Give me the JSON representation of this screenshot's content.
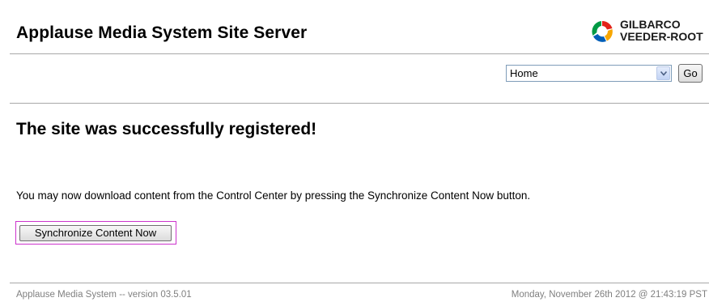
{
  "header": {
    "app_title": "Applause Media System Site Server",
    "logo": {
      "line1": "GILBARCO",
      "line2": "VEEDER-ROOT",
      "colors": [
        "#e2231a",
        "#f7a600",
        "#005eb8",
        "#009a44"
      ]
    }
  },
  "nav": {
    "selected_option": "Home",
    "go_label": "Go"
  },
  "main": {
    "heading": "The site was successfully registered!",
    "message": "You may now download content from the Control Center by pressing the Synchronize Content Now button.",
    "sync_button_label": "Synchronize Content Now",
    "highlight_color": "#cc33cc"
  },
  "footer": {
    "version_text": "Applause Media System -- version 03.5.01",
    "timestamp": "Monday, November 26th 2012 @ 21:43:19 PST"
  }
}
